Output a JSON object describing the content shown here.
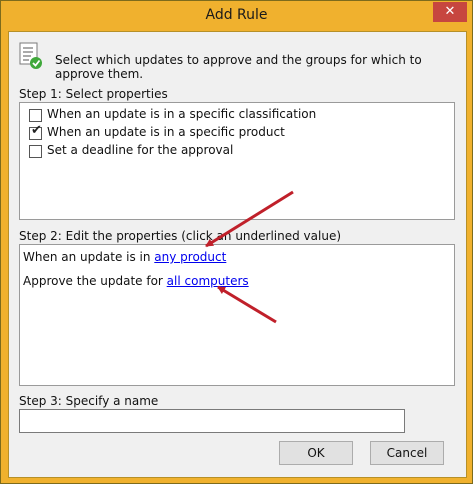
{
  "window": {
    "title": "Add Rule",
    "close_glyph": "✕"
  },
  "intro": "Select which updates to approve and the groups for which to approve them.",
  "step1": {
    "label": "Step 1: Select properties",
    "options": [
      {
        "label": "When an update is in a specific classification",
        "checked": false
      },
      {
        "label": "When an update is in a specific product",
        "checked": true
      },
      {
        "label": "Set a deadline for the approval",
        "checked": false
      }
    ]
  },
  "step2": {
    "label": "Step 2: Edit the properties (click an underlined value)",
    "line1_prefix": "When an update is in ",
    "line1_link": "any product",
    "line2_prefix": "Approve the update for ",
    "line2_link": "all computers"
  },
  "step3": {
    "label": "Step 3: Specify a name",
    "name_value": ""
  },
  "buttons": {
    "ok": "OK",
    "cancel": "Cancel"
  },
  "colors": {
    "title_bar": "#f0b12e",
    "close_button": "#c7463f",
    "link": "#0000ee",
    "arrow": "#c0202a"
  },
  "icons": {
    "header": "checklist-check-icon",
    "close": "close-icon"
  }
}
